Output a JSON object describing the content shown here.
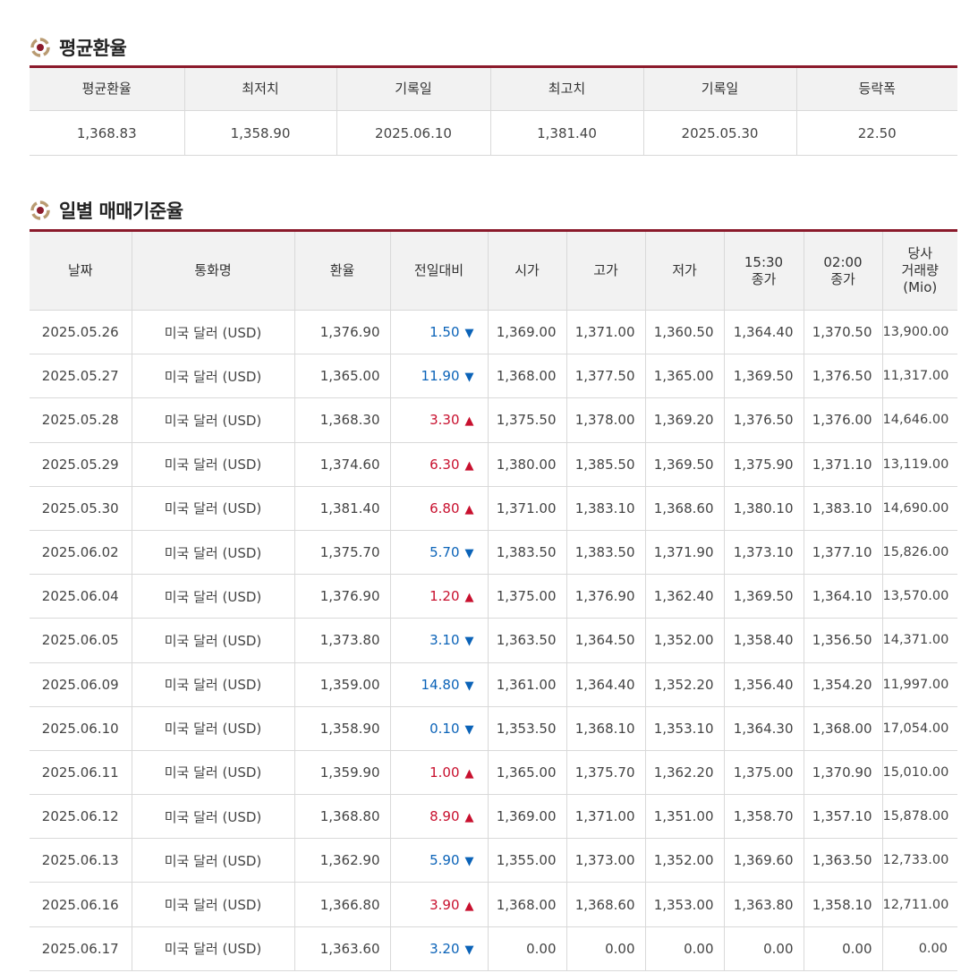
{
  "average_section": {
    "title": "평균환율",
    "headers": [
      "평균환율",
      "최저치",
      "기록일",
      "최고치",
      "기록일",
      "등락폭"
    ],
    "values": [
      "1,368.83",
      "1,358.90",
      "2025.06.10",
      "1,381.40",
      "2025.05.30",
      "22.50"
    ]
  },
  "daily_section": {
    "title": "일별 매매기준율",
    "headers": [
      "날짜",
      "통화명",
      "환율",
      "전일대비",
      "시가",
      "고가",
      "저가",
      "15:30\n종가",
      "02:00\n종가",
      "당사\n거래량\n(Mio)"
    ],
    "rows": [
      {
        "date": "2025.05.26",
        "currency": "미국 달러 (USD)",
        "rate": "1,376.90",
        "change": "1.50",
        "dir": "down",
        "open": "1,369.00",
        "high": "1,371.00",
        "low": "1,360.50",
        "close1530": "1,364.40",
        "close0200": "1,370.50",
        "volume": "13,900.00"
      },
      {
        "date": "2025.05.27",
        "currency": "미국 달러 (USD)",
        "rate": "1,365.00",
        "change": "11.90",
        "dir": "down",
        "open": "1,368.00",
        "high": "1,377.50",
        "low": "1,365.00",
        "close1530": "1,369.50",
        "close0200": "1,376.50",
        "volume": "11,317.00"
      },
      {
        "date": "2025.05.28",
        "currency": "미국 달러 (USD)",
        "rate": "1,368.30",
        "change": "3.30",
        "dir": "up",
        "open": "1,375.50",
        "high": "1,378.00",
        "low": "1,369.20",
        "close1530": "1,376.50",
        "close0200": "1,376.00",
        "volume": "14,646.00"
      },
      {
        "date": "2025.05.29",
        "currency": "미국 달러 (USD)",
        "rate": "1,374.60",
        "change": "6.30",
        "dir": "up",
        "open": "1,380.00",
        "high": "1,385.50",
        "low": "1,369.50",
        "close1530": "1,375.90",
        "close0200": "1,371.10",
        "volume": "13,119.00"
      },
      {
        "date": "2025.05.30",
        "currency": "미국 달러 (USD)",
        "rate": "1,381.40",
        "change": "6.80",
        "dir": "up",
        "open": "1,371.00",
        "high": "1,383.10",
        "low": "1,368.60",
        "close1530": "1,380.10",
        "close0200": "1,383.10",
        "volume": "14,690.00"
      },
      {
        "date": "2025.06.02",
        "currency": "미국 달러 (USD)",
        "rate": "1,375.70",
        "change": "5.70",
        "dir": "down",
        "open": "1,383.50",
        "high": "1,383.50",
        "low": "1,371.90",
        "close1530": "1,373.10",
        "close0200": "1,377.10",
        "volume": "15,826.00"
      },
      {
        "date": "2025.06.04",
        "currency": "미국 달러 (USD)",
        "rate": "1,376.90",
        "change": "1.20",
        "dir": "up",
        "open": "1,375.00",
        "high": "1,376.90",
        "low": "1,362.40",
        "close1530": "1,369.50",
        "close0200": "1,364.10",
        "volume": "13,570.00"
      },
      {
        "date": "2025.06.05",
        "currency": "미국 달러 (USD)",
        "rate": "1,373.80",
        "change": "3.10",
        "dir": "down",
        "open": "1,363.50",
        "high": "1,364.50",
        "low": "1,352.00",
        "close1530": "1,358.40",
        "close0200": "1,356.50",
        "volume": "14,371.00"
      },
      {
        "date": "2025.06.09",
        "currency": "미국 달러 (USD)",
        "rate": "1,359.00",
        "change": "14.80",
        "dir": "down",
        "open": "1,361.00",
        "high": "1,364.40",
        "low": "1,352.20",
        "close1530": "1,356.40",
        "close0200": "1,354.20",
        "volume": "11,997.00"
      },
      {
        "date": "2025.06.10",
        "currency": "미국 달러 (USD)",
        "rate": "1,358.90",
        "change": "0.10",
        "dir": "down",
        "open": "1,353.50",
        "high": "1,368.10",
        "low": "1,353.10",
        "close1530": "1,364.30",
        "close0200": "1,368.00",
        "volume": "17,054.00"
      },
      {
        "date": "2025.06.11",
        "currency": "미국 달러 (USD)",
        "rate": "1,359.90",
        "change": "1.00",
        "dir": "up",
        "open": "1,365.00",
        "high": "1,375.70",
        "low": "1,362.20",
        "close1530": "1,375.00",
        "close0200": "1,370.90",
        "volume": "15,010.00"
      },
      {
        "date": "2025.06.12",
        "currency": "미국 달러 (USD)",
        "rate": "1,368.80",
        "change": "8.90",
        "dir": "up",
        "open": "1,369.00",
        "high": "1,371.00",
        "low": "1,351.00",
        "close1530": "1,358.70",
        "close0200": "1,357.10",
        "volume": "15,878.00"
      },
      {
        "date": "2025.06.13",
        "currency": "미국 달러 (USD)",
        "rate": "1,362.90",
        "change": "5.90",
        "dir": "down",
        "open": "1,355.00",
        "high": "1,373.00",
        "low": "1,352.00",
        "close1530": "1,369.60",
        "close0200": "1,363.50",
        "volume": "12,733.00"
      },
      {
        "date": "2025.06.16",
        "currency": "미국 달러 (USD)",
        "rate": "1,366.80",
        "change": "3.90",
        "dir": "up",
        "open": "1,368.00",
        "high": "1,368.60",
        "low": "1,353.00",
        "close1530": "1,363.80",
        "close0200": "1,358.10",
        "volume": "12,711.00"
      },
      {
        "date": "2025.06.17",
        "currency": "미국 달러 (USD)",
        "rate": "1,363.60",
        "change": "3.20",
        "dir": "down",
        "open": "0.00",
        "high": "0.00",
        "low": "0.00",
        "close1530": "0.00",
        "close0200": "0.00",
        "volume": "0.00"
      }
    ]
  },
  "colors": {
    "accent_border": "#8b1a2b",
    "up": "#c8102e",
    "down": "#0b63b8",
    "header_bg": "#f2f2f2"
  },
  "icons": {
    "section": "ring-bullet-icon",
    "up": "triangle-up-icon",
    "down": "triangle-down-icon"
  }
}
